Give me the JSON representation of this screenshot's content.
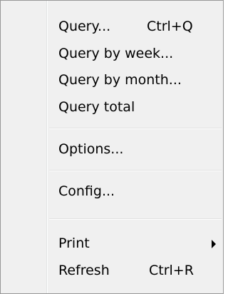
{
  "menu": {
    "items": [
      {
        "label": "Query...",
        "shortcut": "Ctrl+Q"
      },
      {
        "label": "Query by week..."
      },
      {
        "label": "Query by month..."
      },
      {
        "label": "Query total"
      },
      {
        "label": "Options..."
      },
      {
        "label": "Config..."
      },
      {
        "label": "Print",
        "submenu": true
      },
      {
        "label": "Refresh",
        "shortcut": "Ctrl+R"
      }
    ]
  }
}
